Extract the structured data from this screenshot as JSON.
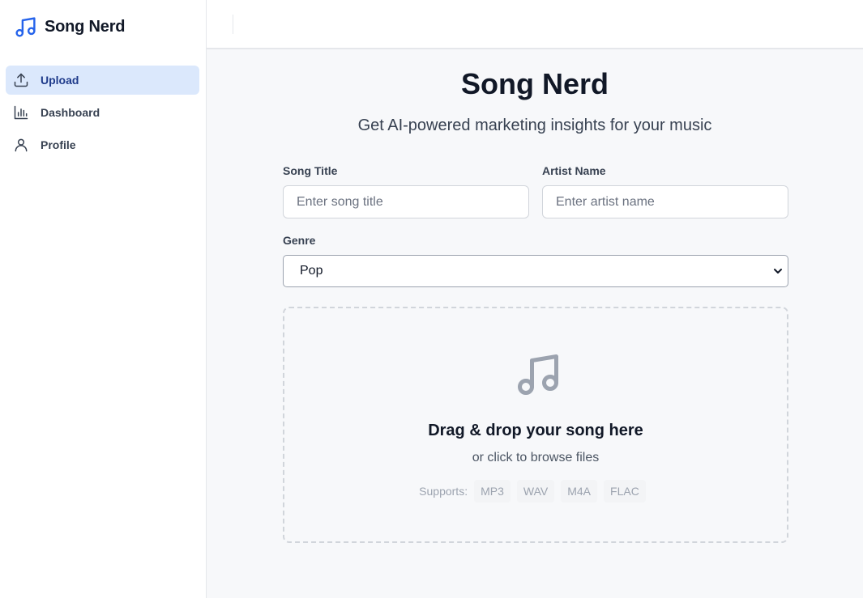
{
  "app": {
    "name": "Song Nerd"
  },
  "sidebar": {
    "items": [
      {
        "label": "Upload",
        "icon": "upload-icon",
        "active": true
      },
      {
        "label": "Dashboard",
        "icon": "bar-chart-icon",
        "active": false
      },
      {
        "label": "Profile",
        "icon": "user-icon",
        "active": false
      }
    ]
  },
  "main": {
    "title": "Song Nerd",
    "subtitle": "Get AI-powered marketing insights for your music"
  },
  "form": {
    "song_title": {
      "label": "Song Title",
      "placeholder": "Enter song title",
      "value": ""
    },
    "artist_name": {
      "label": "Artist Name",
      "placeholder": "Enter artist name",
      "value": ""
    },
    "genre": {
      "label": "Genre",
      "selected": "Pop"
    }
  },
  "dropzone": {
    "title": "Drag & drop your song here",
    "subtitle": "or click to browse files",
    "supports_label": "Supports:",
    "formats": [
      "MP3",
      "WAV",
      "M4A",
      "FLAC"
    ]
  },
  "colors": {
    "accent": "#2563eb",
    "active_nav_bg": "#dbe8fc",
    "page_bg": "#f7f8fa"
  }
}
